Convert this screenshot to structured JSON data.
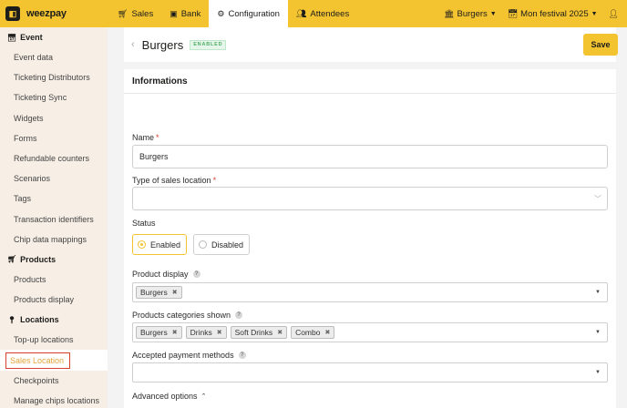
{
  "app": {
    "logo_text": "weezpay"
  },
  "topnav": {
    "items": [
      {
        "label": "Sales",
        "icon": "cart-icon"
      },
      {
        "label": "Bank",
        "icon": "money-icon"
      },
      {
        "label": "Configuration",
        "icon": "gear-icon"
      },
      {
        "label": "Attendees",
        "icon": "users-icon"
      }
    ],
    "active_index": 2,
    "store": "Burgers",
    "event": "Mon festival 2025"
  },
  "sidebar": {
    "event": {
      "heading": "Event",
      "items": [
        "Event data",
        "Ticketing Distributors",
        "Ticketing Sync",
        "Widgets",
        "Forms",
        "Refundable counters",
        "Scenarios",
        "Tags",
        "Transaction identifiers",
        "Chip data mappings"
      ]
    },
    "products": {
      "heading": "Products",
      "items": [
        "Products",
        "Products display"
      ]
    },
    "locations": {
      "heading": "Locations",
      "items": [
        "Top-up locations",
        "Sales Location",
        "Checkpoints",
        "Manage chips locations"
      ],
      "active_index": 1
    }
  },
  "header": {
    "title": "Burgers",
    "badge": "ENABLED",
    "save_label": "Save"
  },
  "form": {
    "title": "Informations",
    "name_label": "Name",
    "name_value": "Burgers",
    "type_label": "Type of sales location",
    "type_value": "",
    "status_label": "Status",
    "status_options": [
      "Enabled",
      "Disabled"
    ],
    "status_selected": "Enabled",
    "product_display_label": "Product display",
    "product_display_chips": [
      "Burgers"
    ],
    "categories_label": "Products categories shown",
    "categories_chips": [
      "Burgers",
      "Drinks",
      "Soft Drinks",
      "Combo"
    ],
    "payment_label": "Accepted payment methods",
    "payment_chips": []
  },
  "advanced": {
    "label": "Advanced options"
  },
  "colors": {
    "accent": "#f4c430",
    "sidebar_bg": "#f7efe6",
    "enabled_green": "#4fae66",
    "highlight_red": "#d9412f"
  }
}
